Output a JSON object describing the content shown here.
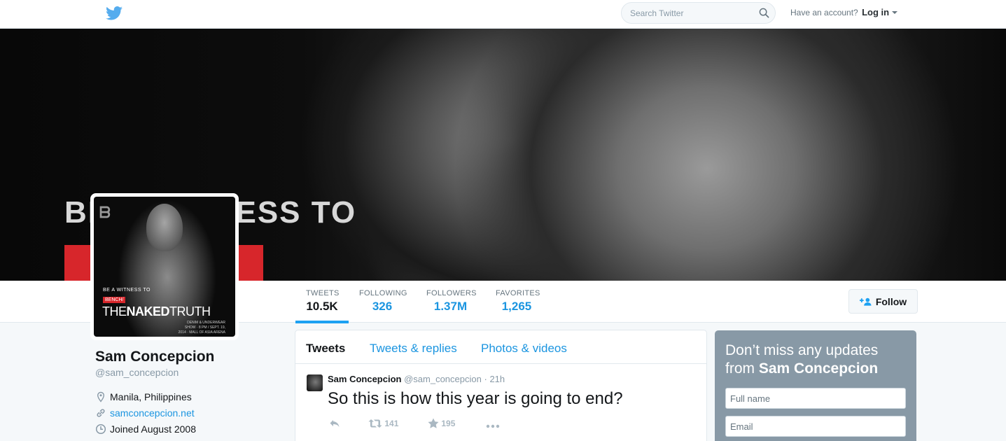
{
  "topbar": {
    "search_placeholder": "Search Twitter",
    "account_prompt": "Have an account?",
    "login_label": "Log in"
  },
  "banner": {
    "overlay_text": "BE A WITNESS TO"
  },
  "avatar": {
    "line1": "BE A WITNESS TO",
    "brand": "BENCH/",
    "title_light": "THE",
    "title_bold": "NAKED",
    "title_end": "TRUTH",
    "meta": "DENIM & UNDERWEAR SHOW · 8 PM / SEPT. 19, 2014 · MALL OF ASIA ARENA"
  },
  "stats": [
    {
      "label": "TWEETS",
      "value": "10.5K",
      "active": true
    },
    {
      "label": "FOLLOWING",
      "value": "326"
    },
    {
      "label": "FOLLOWERS",
      "value": "1.37M"
    },
    {
      "label": "FAVORITES",
      "value": "1,265"
    }
  ],
  "follow_label": "Follow",
  "profile": {
    "name": "Sam Concepcion",
    "handle": "@sam_concepcion",
    "location": "Manila, Philippines",
    "url": "samconcepcion.net",
    "joined": "Joined August 2008"
  },
  "timeline": {
    "tabs": [
      "Tweets",
      "Tweets & replies",
      "Photos & videos"
    ],
    "tweet": {
      "name": "Sam Concepcion",
      "handle": "@sam_concepcion",
      "time": "21h",
      "text": "So this is how this year is going to end?",
      "retweets": "141",
      "favorites": "195"
    }
  },
  "signup": {
    "title_prefix": "Don’t miss any updates from",
    "title_name": "Sam Concepcion",
    "fullname_placeholder": "Full name",
    "email_placeholder": "Email"
  },
  "colors": {
    "accent": "#1da1f2",
    "link": "#1b95e0",
    "signup_bg": "#8899a6",
    "banner_red": "#d7262b"
  }
}
